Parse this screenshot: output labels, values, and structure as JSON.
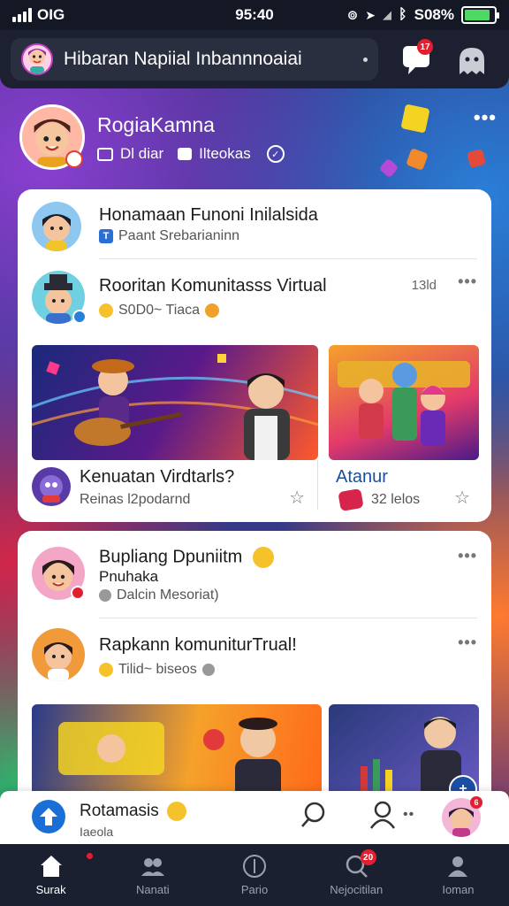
{
  "status_bar": {
    "carrier": "OIG",
    "time": "95:40",
    "battery": "S08%"
  },
  "header": {
    "search_text": "Hibaran Napiial Inbannnoaiai",
    "chat_badge": "17"
  },
  "profile": {
    "name": "RogiaKamna",
    "meta_left": "Dl diar",
    "meta_right": "Ilteokas"
  },
  "feed": {
    "card1": {
      "post1": {
        "title": "Honamaan Funoni Inilalsida",
        "subtitle": "Paant Srebarianinn"
      },
      "post2": {
        "title": "Rooritan Komunitasss Virtual",
        "subtitle": "S0D0~ Tiaca",
        "time": "13ld"
      },
      "media_left_caption": {
        "title": "Kenuatan Virdtarls?",
        "subtitle": "Reinas l2podarnd"
      },
      "media_right_caption": {
        "title": "Atanur",
        "subtitle": "32 lelos"
      }
    },
    "card2": {
      "post1": {
        "title": "Bupliang Dpuniitm",
        "title2": "Pnuhaka",
        "subtitle": "Dalcin Mesoriat)"
      },
      "post2": {
        "title": "Rapkann komuniturTrual!",
        "subtitle": "Tilid~ biseos"
      }
    }
  },
  "mini_bar": {
    "title": "Rotamasis",
    "subtitle": "Iaeola",
    "badge": "6"
  },
  "bottom_nav": [
    {
      "label": "Surak"
    },
    {
      "label": "Nanati"
    },
    {
      "label": "Pario"
    },
    {
      "label": "Nejocitilan",
      "badge": "20"
    },
    {
      "label": "Ioman"
    }
  ],
  "colors": {
    "accent_blue": "#1a6fd6",
    "badge_red": "#e02030",
    "nav_bg": "#1b2030"
  }
}
